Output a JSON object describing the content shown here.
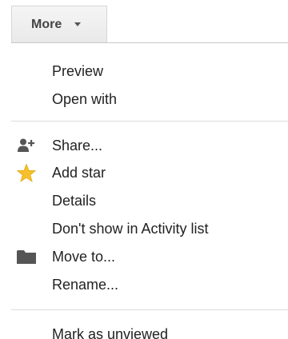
{
  "toolbar": {
    "more_label": "More"
  },
  "menu": {
    "group1": [
      {
        "label": "Preview"
      },
      {
        "label": "Open with"
      }
    ],
    "group2": [
      {
        "label": "Share...",
        "icon": "add-person-icon"
      },
      {
        "label": "Add star",
        "icon": "star-icon"
      },
      {
        "label": "Details"
      },
      {
        "label": "Don't show in Activity list"
      },
      {
        "label": "Move to...",
        "icon": "folder-icon"
      },
      {
        "label": "Rename..."
      }
    ],
    "group3": [
      {
        "label": "Mark as unviewed"
      }
    ]
  },
  "colors": {
    "star": "#f6c02c",
    "icon_gray": "#555555",
    "text": "#222222"
  }
}
